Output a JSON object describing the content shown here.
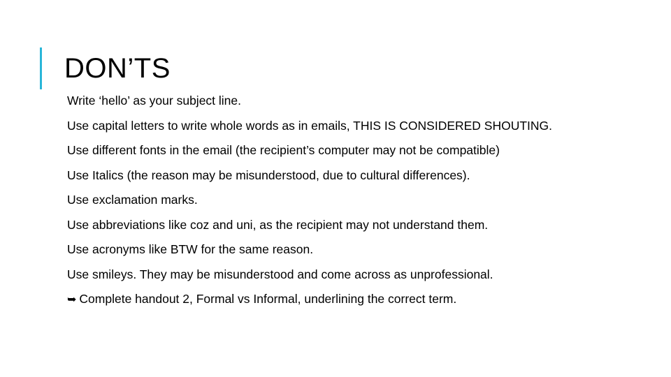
{
  "slide": {
    "title": "DON’TS",
    "accent_color": "#29B6D8",
    "bullets": [
      {
        "text": "Write ‘hello’ as your subject line."
      },
      {
        "text": "Use capital letters to write whole words as in emails, THIS IS CONSIDERED SHOUTING."
      },
      {
        "text": "Use different fonts in the email (the recipient’s computer may not be compatible)"
      },
      {
        "text": "Use Italics (the reason may be misunderstood, due to cultural differences)."
      },
      {
        "text": "Use exclamation marks."
      },
      {
        "text": "Use abbreviations like coz and uni, as the recipient may not understand them."
      },
      {
        "text": "Use acronyms like BTW for the same reason."
      },
      {
        "text": "Use smileys. They may be misunderstood and come across as unprofessional."
      }
    ],
    "final_bullet": {
      "marker": "➥",
      "text": "Complete handout 2, Formal vs Informal, underlining the correct term."
    }
  }
}
